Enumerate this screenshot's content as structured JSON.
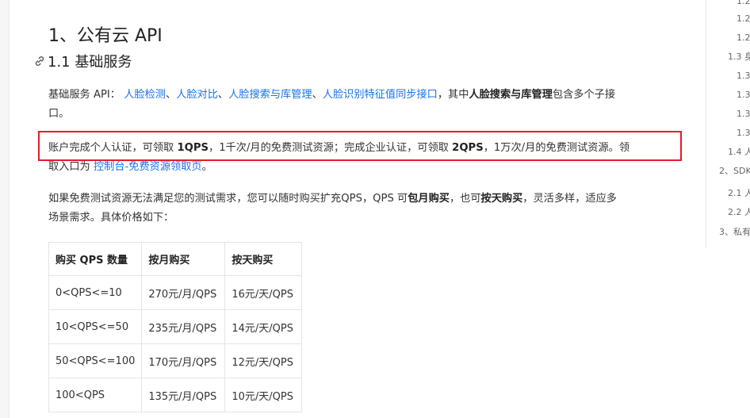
{
  "doc": {
    "h1": "1、公有云 API",
    "h2": "1.1 基础服务",
    "p1": {
      "prefix": "基础服务 API：",
      "links": [
        "人脸检测",
        "人脸对比",
        "人脸搜索与库管理",
        "人脸识别特征值同步接口"
      ],
      "sep": "、",
      "mid": "，其中",
      "bold": "人脸搜索与库管理",
      "suffix": "包含多个子接",
      "line2": "口。"
    },
    "p2": {
      "t1": "账户完成个人认证，可领取 ",
      "b1": "1QPS",
      "t2": "，1千次/月的免费测试资源；完成企业认证，可领取 ",
      "b2": "2QPS",
      "t3": "，1万次/月的免费测试资源。领",
      "t4": "取入口为 ",
      "link": "控制台-免费资源领取页",
      "t5": "。"
    },
    "p3": {
      "t1": "如果免费测试资源无法满足您的测试需求，您可以随时购买扩充QPS，QPS 可",
      "b1": "包月购买",
      "t2": "，也可",
      "b2": "按天购买",
      "t3": "，灵活多样，适应多",
      "line2": "场景需求。具体价格如下："
    },
    "table": {
      "headers": [
        "购买 QPS 数量",
        "按月购买",
        "按天购买"
      ],
      "rows": [
        [
          "0<QPS<=10",
          "270元/月/QPS",
          "16元/天/QPS"
        ],
        [
          "10<QPS<=50",
          "235元/月/QPS",
          "14元/天/QPS"
        ],
        [
          "50<QPS<=100",
          "170元/月/QPS",
          "12元/天/QPS"
        ],
        [
          "100<QPS",
          "135元/月/QPS",
          "10元/天/QPS"
        ]
      ]
    }
  },
  "toc": {
    "items": [
      "1.2.",
      "1.2.",
      "1.2.",
      "1.3 身",
      "1.3.",
      "1.3.",
      "1.3.",
      "1.3.",
      "1.4 人",
      "2、SDK",
      "2.1 人",
      "2.2 人",
      "3、私有"
    ]
  },
  "colors": {
    "link": "#1a73e8",
    "highlight": "#e21b2e"
  }
}
